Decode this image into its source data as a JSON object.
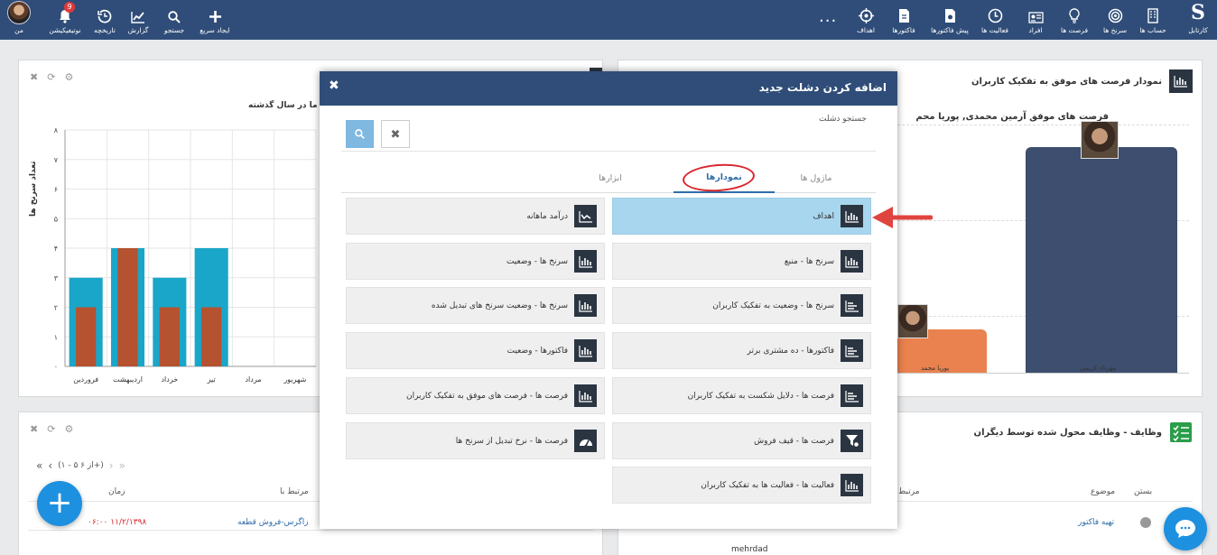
{
  "nav": {
    "right_items": [
      {
        "label": "کارتابل",
        "icon": "logo-s"
      },
      {
        "label": "حساب ها",
        "icon": "building-icon"
      },
      {
        "label": "سرنخ ها",
        "icon": "target-icon"
      },
      {
        "label": "فرصت ها",
        "icon": "lightbulb-icon"
      },
      {
        "label": "افراد",
        "icon": "contact-card-icon"
      },
      {
        "label": "فعالیت ها",
        "icon": "clock-icon"
      },
      {
        "label": "پیش فاکتورها",
        "icon": "document-icon"
      },
      {
        "label": "فاکتورها",
        "icon": "invoice-icon"
      },
      {
        "label": "اهداف",
        "icon": "crosshair-icon"
      }
    ],
    "more": "...",
    "left_items": [
      {
        "label": "ایجاد سریع",
        "icon": "plus-icon"
      },
      {
        "label": "جستجو",
        "icon": "search-icon"
      },
      {
        "label": "گزارش",
        "icon": "chart-line-icon"
      },
      {
        "label": "تاریخچه",
        "icon": "history-icon"
      },
      {
        "label": "نوتیفیکیشن",
        "icon": "bell-icon"
      },
      {
        "label": "من",
        "icon": "avatar"
      }
    ],
    "notification_count": "9"
  },
  "left_panel": {
    "chart_title": "ما در سال گذشته",
    "chart_data": {
      "type": "bar",
      "title": "ما در سال گذشته",
      "ylabel": "تعداد سرنخ ها",
      "xlabel": "",
      "ylim": [
        0,
        8
      ],
      "y_ticks": [
        "۰",
        "۱",
        "۲",
        "۳",
        "۴",
        "۵",
        "۶",
        "۷",
        "۸"
      ],
      "categories": [
        "فروردین",
        "اردیبهشت",
        "خرداد",
        "تیر",
        "مرداد",
        "شهریور"
      ],
      "series": [
        {
          "values": [
            3,
            4,
            3,
            4,
            0,
            0
          ],
          "color": "#1aa6c8"
        },
        {
          "values": [
            2,
            4,
            2,
            2,
            0,
            0
          ],
          "color": "#b5522f"
        }
      ]
    }
  },
  "right_panel": {
    "title": "نمودار فرصت های موفق به تفکیک کاربران",
    "subtitle": "فرصت های موفق آرمین محمدی, پوریا محم",
    "bar_labels": [
      "مهرداد کریمی",
      "پوریا محمد"
    ]
  },
  "bottom_left": {
    "pager_text": "(۱ - ۵ از ۶+)",
    "col_time": "زمان",
    "col_related": "مرتبط با",
    "rows": [
      {
        "time": "۱۱/۲/۱۳۹۸ ۰۶:۰۰",
        "related": "زاگرس-فروش قطعه"
      }
    ]
  },
  "bottom_right": {
    "title": "وظایف - وظایف محول شده توسط دیگران",
    "col_close": "بستن",
    "col_subject": "موضوع",
    "col_related": "مرتبط",
    "rows": [
      {
        "subject": "تهیه فاکتور",
        "user": "mehrdad"
      }
    ]
  },
  "modal": {
    "title": "اضافه کردن دشلت جدید",
    "search_placeholder": "جستجو دشلت",
    "tabs": [
      "ماژول ها",
      "نمودارها",
      "ابزارها"
    ],
    "active_tab": 1,
    "items_right": [
      {
        "label": "اهداف",
        "icon": "bar-chart-icon",
        "selected": true
      },
      {
        "label": "سرنخ ها - منبع",
        "icon": "bar-chart-icon"
      },
      {
        "label": "سرنخ ها - وضعیت به تفکیک کاربران",
        "icon": "hbar-chart-icon"
      },
      {
        "label": "فاکتورها - ده مشتری برتر",
        "icon": "hbar-chart-icon"
      },
      {
        "label": "فرصت ها - دلایل شکست به تفکیک کاربران",
        "icon": "hbar-chart-icon"
      },
      {
        "label": "فرصت ها - قیف فروش",
        "icon": "funnel-icon"
      },
      {
        "label": "فعالیت ها - فعالیت ها به تفکیک کاربران",
        "icon": "bar-chart-icon"
      }
    ],
    "items_left": [
      {
        "label": "درآمد ماهانه",
        "icon": "area-chart-icon"
      },
      {
        "label": "سرنخ ها - وضعیت",
        "icon": "bar-chart-icon"
      },
      {
        "label": "سرنخ ها - وضعیت سرنخ های تبدیل شده",
        "icon": "bar-chart-icon"
      },
      {
        "label": "فاکتورها - وضعیت",
        "icon": "bar-chart-icon"
      },
      {
        "label": "فرصت ها - فرصت های موفق به تفکیک کاربران",
        "icon": "bar-chart-icon"
      },
      {
        "label": "فرصت ها - نرخ تبدیل از سرنخ ها",
        "icon": "gauge-icon"
      }
    ]
  },
  "colors": {
    "nav_bg": "#2f4d78",
    "selected_item": "#a8d6ee",
    "accent_blue": "#1e90e0",
    "annotation_red": "#d9262b"
  }
}
